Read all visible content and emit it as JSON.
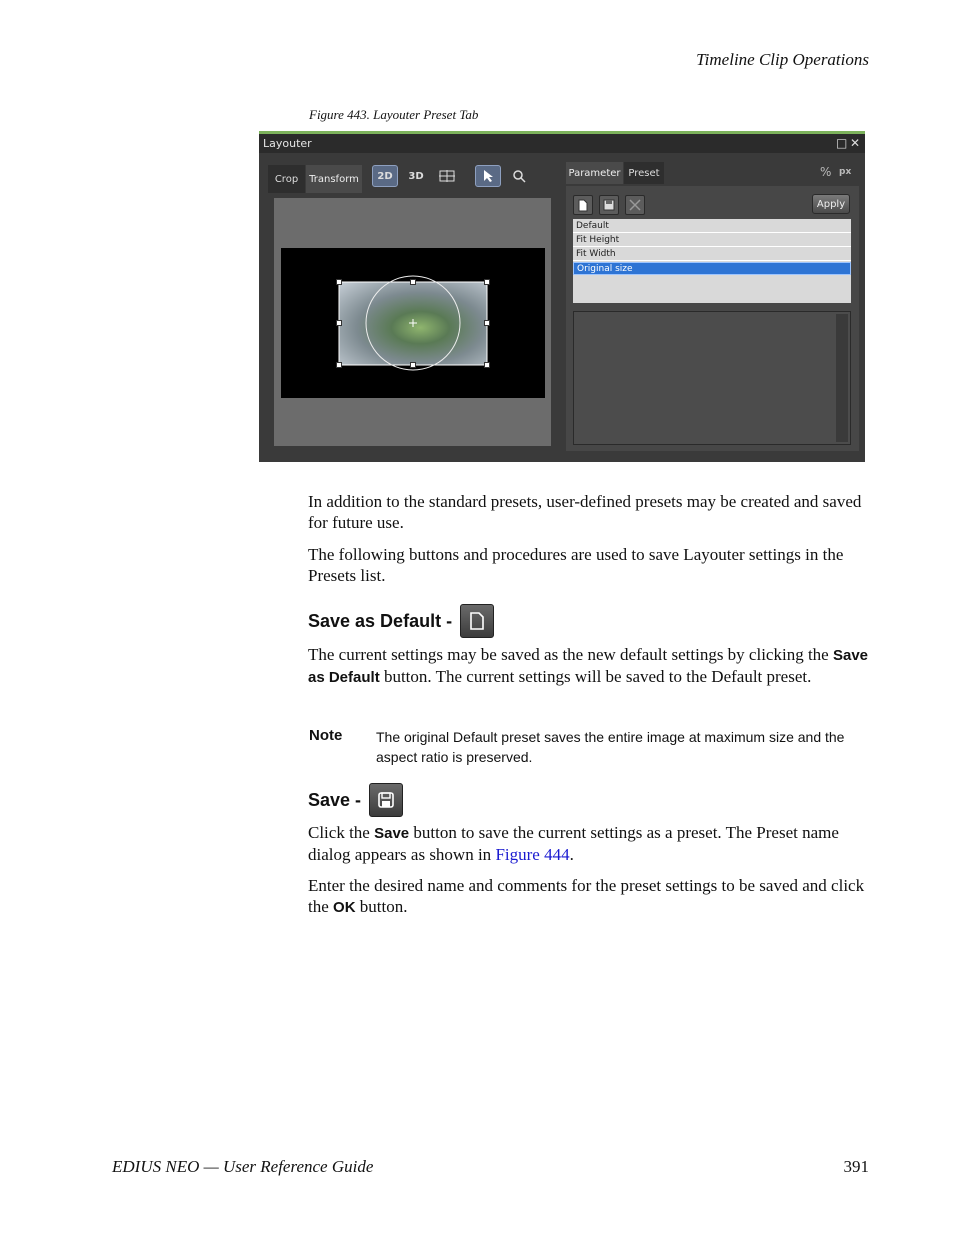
{
  "header": {
    "section": "Timeline Clip Operations"
  },
  "figure": {
    "caption": "Figure 443.  Layouter Preset Tab",
    "window_title": "Layouter",
    "left_tabs": [
      "Crop",
      "Transform"
    ],
    "toolbar_buttons": [
      "2D",
      "3D",
      "grid-icon",
      "pointer-icon",
      "zoom-icon"
    ],
    "right_tabs": [
      "Parameter",
      "Preset"
    ],
    "unit_labels": [
      "%",
      "px"
    ],
    "apply_label": "Apply",
    "presets": [
      {
        "label": "Default",
        "selected": false
      },
      {
        "label": "Fit Height",
        "selected": false
      },
      {
        "label": "Fit Width",
        "selected": false
      },
      {
        "label": "Original size",
        "selected": true
      }
    ],
    "colors": {
      "selection": "#2e74d4",
      "title_accent": "#7db35c"
    }
  },
  "body": {
    "p1": "In addition to the standard presets, user-defined presets may be created and saved for future use.",
    "p2": "The following buttons and procedures are used to save Layouter settings in the Presets list.",
    "h_default": "Save as Default -",
    "p3_a": "The current settings may be saved as the new default settings by clicking the ",
    "p3_kw": "Save as Default",
    "p3_b": " button. The current settings will be saved to the Default preset.",
    "note_label": "Note",
    "note_text": "The original Default preset saves the entire image at maximum size and the aspect ratio is preserved.",
    "h_save": "Save -",
    "p4_a": "Click the ",
    "p4_kw": "Save",
    "p4_b": " button to save the current settings as a preset. The Preset name dialog appears as shown in ",
    "p4_link": "Figure 444",
    "p4_c": ".",
    "p5_a": "Enter the desired name and comments for the preset settings to be saved and click the ",
    "p5_kw": "OK",
    "p5_b": " button."
  },
  "footer": {
    "guide": "EDIUS NEO  —  User Reference Guide",
    "page": "391"
  }
}
